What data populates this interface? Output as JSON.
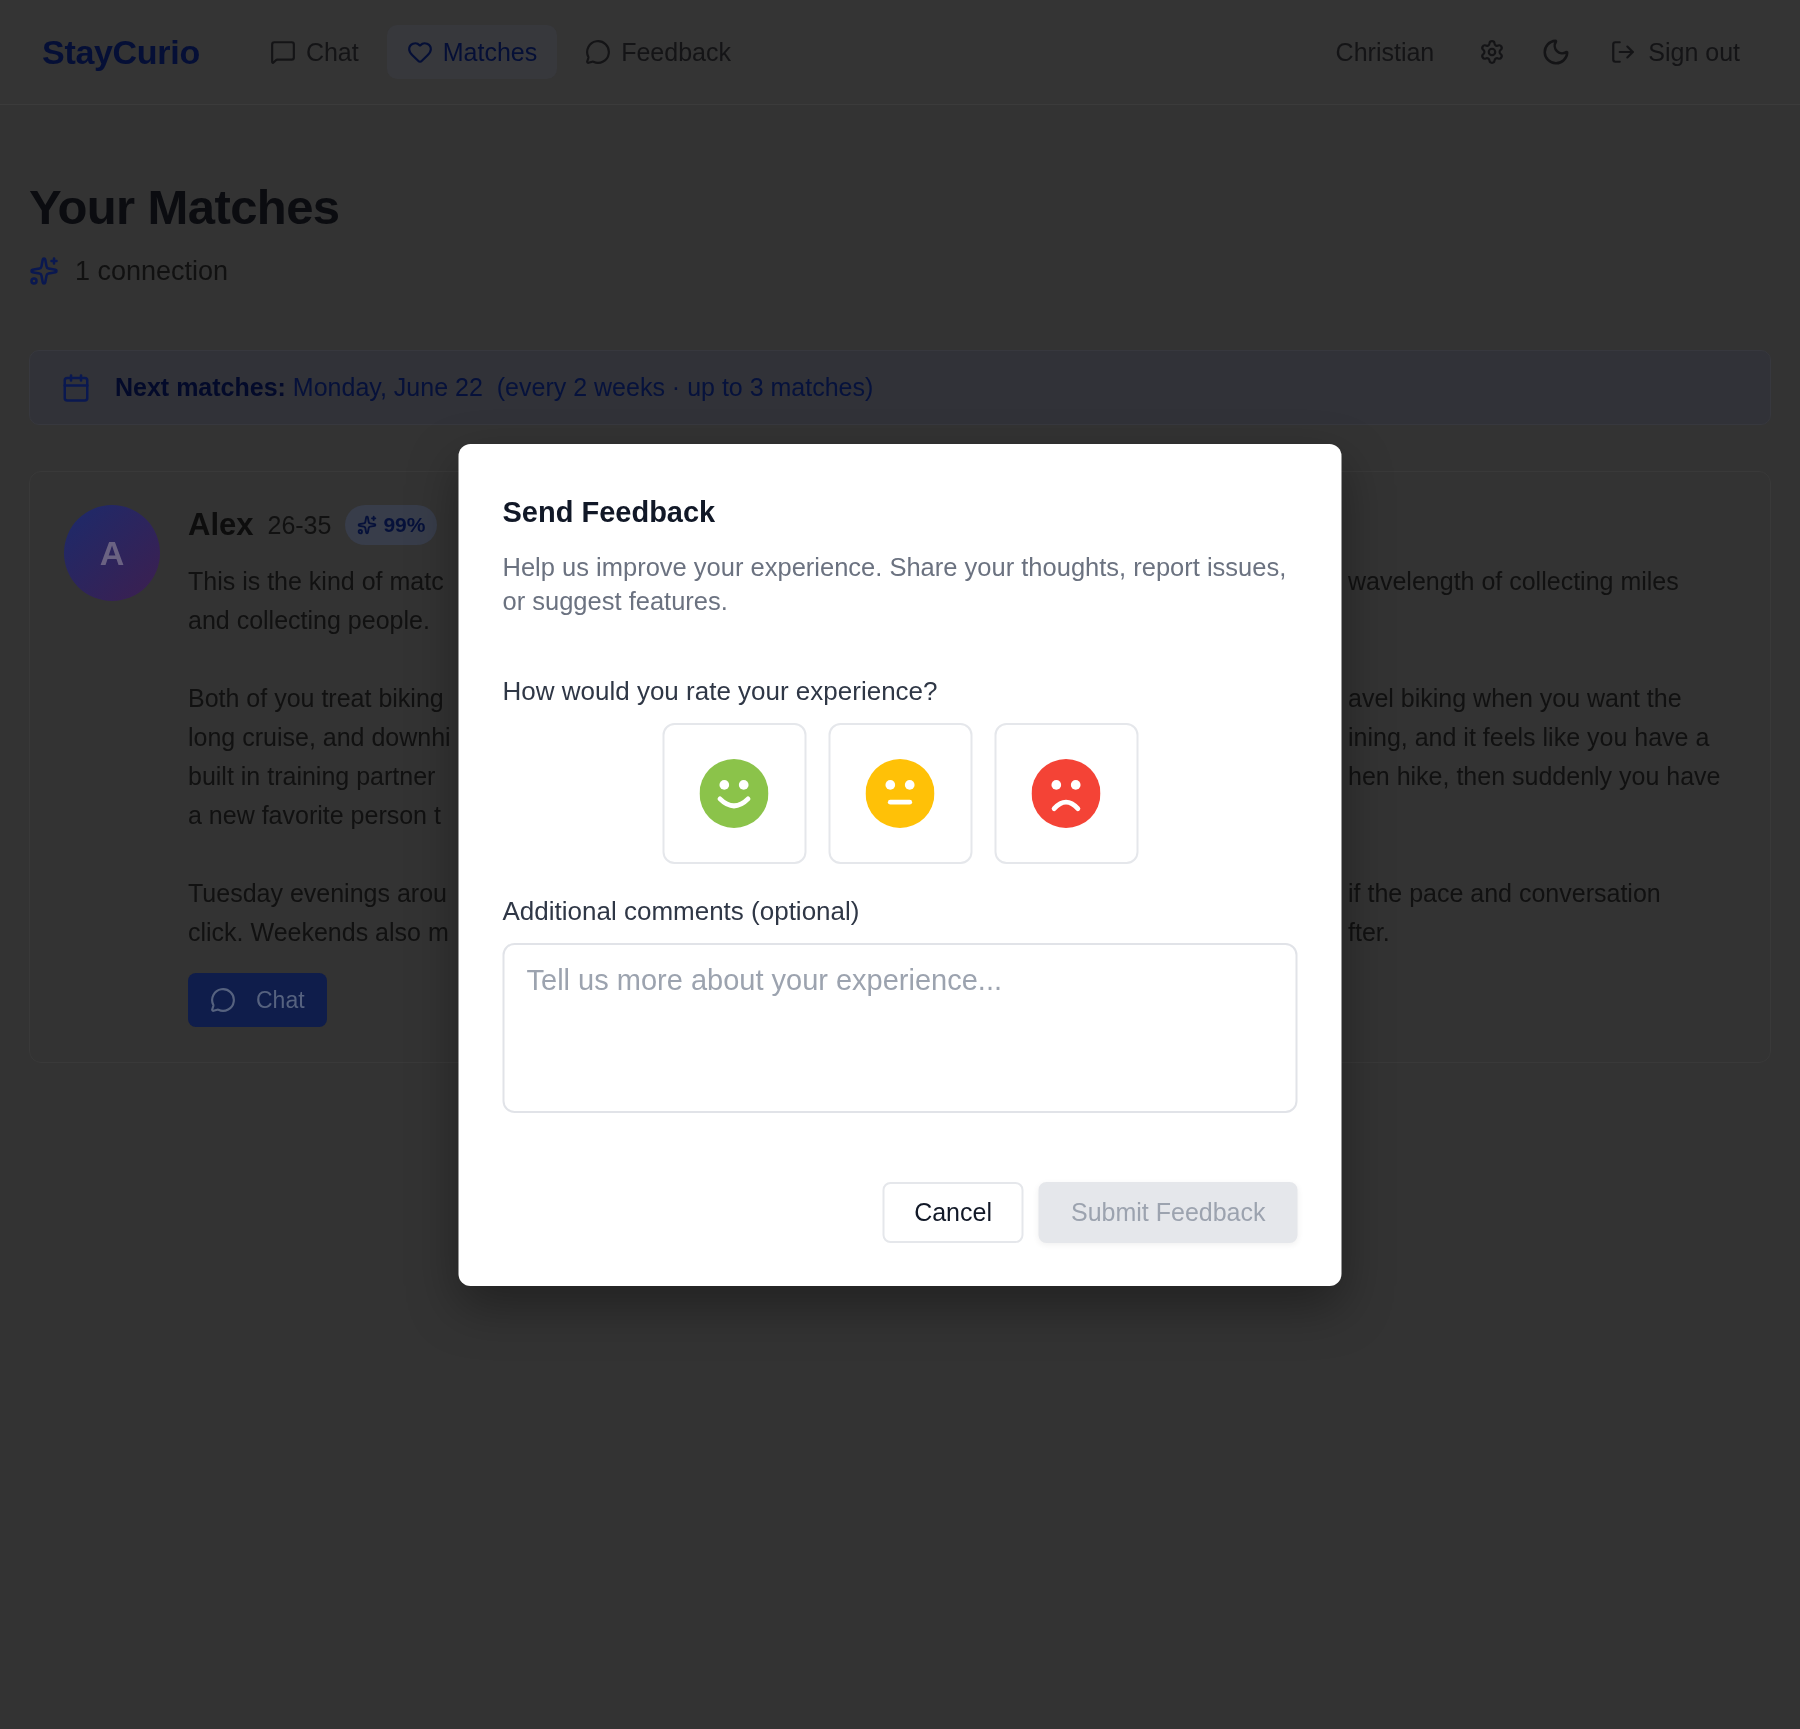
{
  "header": {
    "logo": "StayCurio",
    "nav": [
      {
        "label": "Chat",
        "selected": false
      },
      {
        "label": "Matches",
        "selected": true
      },
      {
        "label": "Feedback",
        "selected": false
      }
    ],
    "user_name": "Christian",
    "sign_out": "Sign out"
  },
  "page": {
    "title": "Your Matches",
    "connection_count": "1 connection"
  },
  "schedule_banner": {
    "next_matches": "**Next matches:** Monday, June 22",
    "frequency": "(every 2 weeks · up to 3 matches)"
  },
  "match_card": {
    "avatar_initial": "A",
    "name": "Alex",
    "age_range": "26-35",
    "score": "99%",
    "paragraphs": [
      {
        "lines": [
          {
            "left": "This is the kind of matc",
            "right": "wavelength of collecting miles"
          },
          {
            "left": "and collecting people."
          }
        ]
      },
      {
        "lines": [
          {
            "left": "Both of you treat biking",
            "right": "avel biking when you want the"
          },
          {
            "left": "long cruise, and downhi",
            "right": "ining, and it feels like you have a"
          },
          {
            "left": "built in training partner",
            "right": "hen hike, then suddenly you have"
          },
          {
            "left": "a new favorite person t"
          }
        ]
      },
      {
        "lines": [
          {
            "left": "Tuesday evenings arou",
            "right": "if the pace and conversation"
          },
          {
            "left": "click. Weekends also m",
            "right": "fter."
          }
        ]
      }
    ],
    "chat_button": "Chat"
  },
  "feedback_dialog": {
    "title": "Send Feedback",
    "description": "Help us improve your experience. Share your thoughts, report issues, or suggest features.",
    "rating_question": "How would you rate your experience?",
    "rating_options": [
      {
        "kind": "happy",
        "selected": false
      },
      {
        "kind": "neutral",
        "selected": false
      },
      {
        "kind": "sad",
        "selected": false
      }
    ],
    "comments_label": "Additional comments (optional)",
    "comments_field": {
      "placeholder": "Tell us more about your experience..."
    },
    "buttons": [
      {
        "label": "Cancel",
        "kind": "outline",
        "disabled": false
      },
      {
        "label": "Submit Feedback",
        "kind": "primary",
        "disabled": true
      }
    ]
  }
}
